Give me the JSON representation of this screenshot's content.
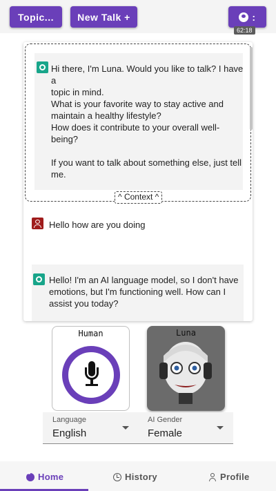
{
  "toolbar": {
    "topic_label": "Topic...",
    "new_talk_label": "New Talk +",
    "user_menu_label": ":",
    "timer": "62:18"
  },
  "chat": {
    "context_message": {
      "lines": [
        "Hi there, I'm Luna. Would you like to talk? I have a",
        "topic in mind.",
        "What is your favorite way to stay active and",
        "maintain a healthy lifestyle?",
        "How does it contribute to your overall well-being?",
        "",
        "If you want to talk about something else, just tell",
        "me."
      ]
    },
    "context_tab_label": "^ Context ^",
    "user_message": "Hello how are you doing",
    "bot_message": {
      "lines": [
        "Hello! I'm an AI language model, so I don't have",
        "emotions, but I'm functioning well. How can I",
        "assist you today?"
      ]
    }
  },
  "avatars": {
    "human_title": "Human",
    "luna_title": "Luna"
  },
  "settings": {
    "language_label": "Language",
    "language_value": "English",
    "gender_label": "AI Gender",
    "gender_value": "Female"
  },
  "nav": {
    "home": "Home",
    "history": "History",
    "profile": "Profile"
  },
  "colors": {
    "accent": "#6a3fb9",
    "bot_icon": "#18a58a",
    "user_icon": "#a01c1c"
  }
}
